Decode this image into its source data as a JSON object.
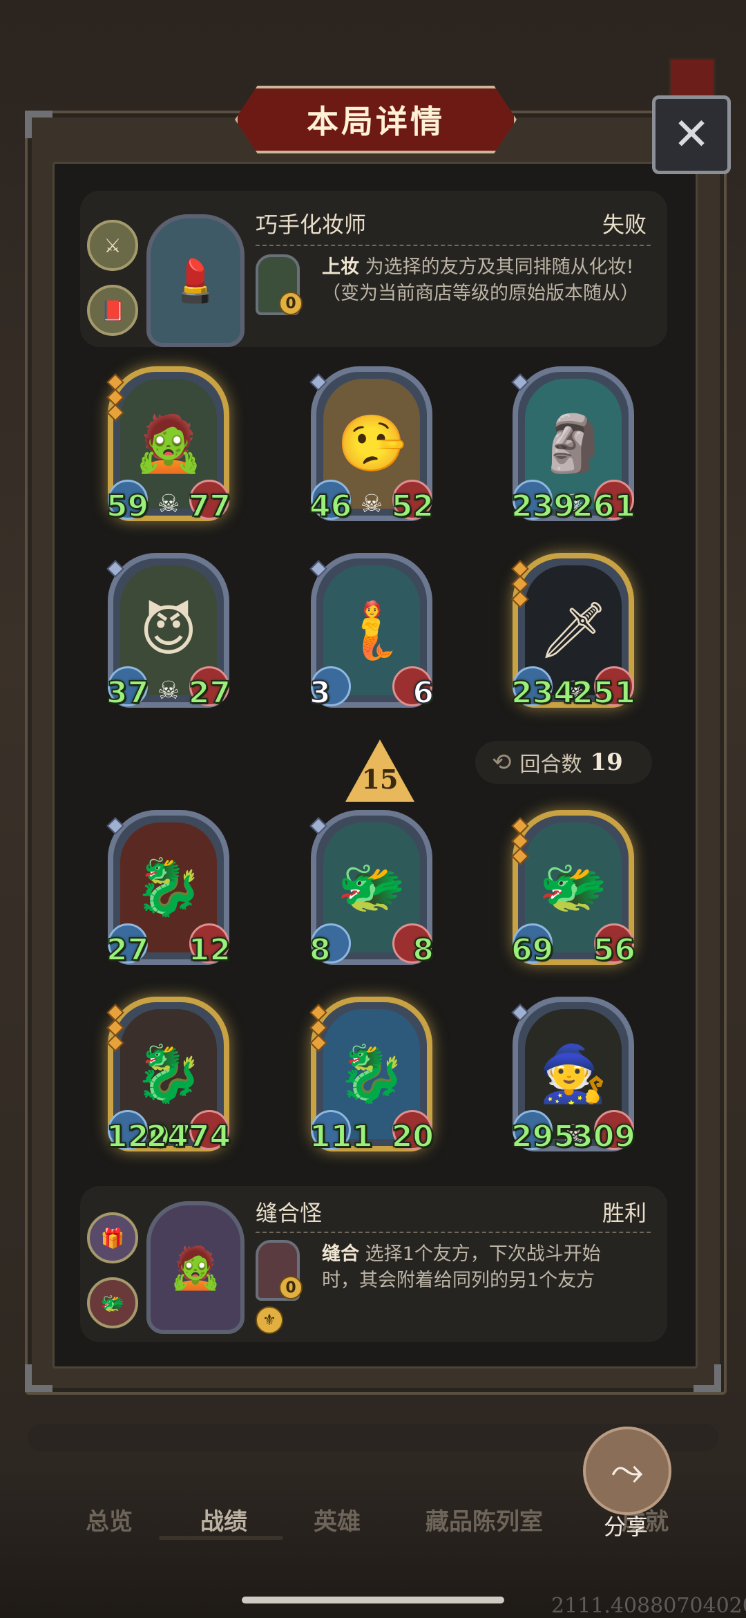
{
  "title": "本局详情",
  "close_icon": "✕",
  "top_player": {
    "name": "巧手化妆师",
    "result": "失败",
    "skill_name": "上妆",
    "skill_desc_1": "为选择的友方及其同排随从化妆!",
    "skill_desc_2": "（变为当前商店等级的原始版本随从）",
    "skill_cost": "0"
  },
  "top_board": [
    {
      "atk": "59",
      "hp": "77",
      "gold": true,
      "skull": true,
      "art": "🧟",
      "bg": "#394a3a"
    },
    {
      "atk": "46",
      "hp": "52",
      "gold": false,
      "skull": true,
      "art": "🤥",
      "bg": "#6f5a3a"
    },
    {
      "atk": "239",
      "hp": "261",
      "gold": false,
      "skull": true,
      "art": "🗿",
      "bg": "#2f6b6b"
    },
    {
      "atk": "37",
      "hp": "27",
      "gold": false,
      "skull": true,
      "art": "😈",
      "bg": "#3d4a38"
    },
    {
      "atk": "3",
      "hp": "6",
      "gold": false,
      "skull": false,
      "art": "🧜",
      "bg": "#2f5a60",
      "white": true
    },
    {
      "atk": "234",
      "hp": "251",
      "gold": true,
      "skull": true,
      "art": "🗡",
      "bg": "#1f2226"
    }
  ],
  "tier": "15",
  "round_label": "回合数",
  "round_value": "19",
  "bottom_board": [
    {
      "atk": "27",
      "hp": "12",
      "gold": false,
      "skull": false,
      "art": "🐉",
      "bg": "#5a2a22"
    },
    {
      "atk": "8",
      "hp": "8",
      "gold": false,
      "skull": false,
      "art": "🐲",
      "bg": "#2f5a5a"
    },
    {
      "atk": "69",
      "hp": "56",
      "gold": true,
      "skull": false,
      "art": "🐲",
      "bg": "#2f5a5a"
    },
    {
      "atk": "1207",
      "hp": "2474",
      "gold": true,
      "skull": false,
      "art": "🐉",
      "bg": "#3a2f2a"
    },
    {
      "atk": "111",
      "hp": "20",
      "gold": true,
      "skull": false,
      "art": "🐉",
      "bg": "#2d5a7a"
    },
    {
      "atk": "295",
      "hp": "309",
      "gold": false,
      "skull": true,
      "art": "🧙",
      "bg": "#2a2a24"
    }
  ],
  "bottom_player": {
    "name": "缝合怪",
    "result": "胜利",
    "skill_name": "缝合",
    "skill_desc_1": "选择1个友方，下次战斗开始",
    "skill_desc_2": "时，其会附着给同列的另1个友方",
    "skill_cost": "0"
  },
  "nav": [
    "总览",
    "战绩",
    "英雄",
    "藏品陈列室",
    "成就"
  ],
  "share_label": "分享",
  "watermark": "2111.40880704020"
}
